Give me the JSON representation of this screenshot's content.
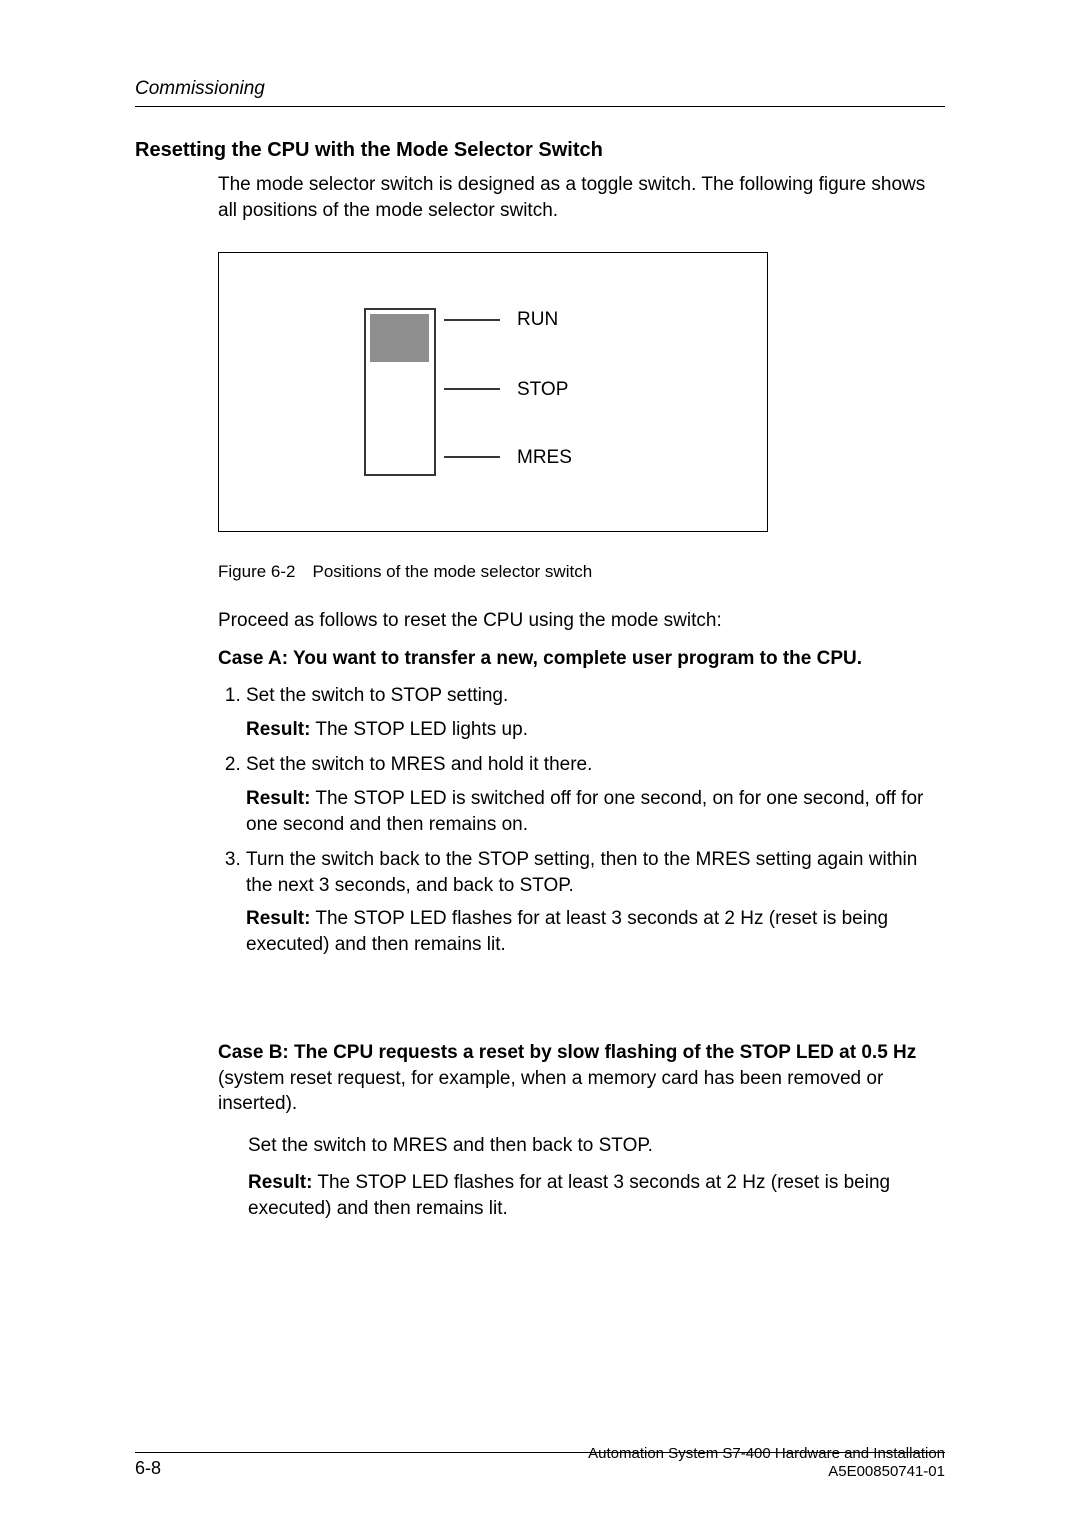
{
  "running_head": "Commissioning",
  "heading": "Resetting the CPU with the Mode Selector Switch",
  "intro": "The mode selector switch is designed as a toggle switch. The following figure shows all positions of the mode selector switch.",
  "figure": {
    "labels": {
      "run": "RUN",
      "stop": "STOP",
      "mres": "MRES"
    },
    "caption": "Figure 6-2 Positions of the mode selector switch"
  },
  "proceed": "Proceed as follows to reset the CPU using the mode switch:",
  "case_a": {
    "title": "Case A: You want to transfer a new, complete user program to the CPU.",
    "steps": [
      {
        "text": "Set the switch to STOP setting.",
        "result_label": "Result:",
        "result_text": " The STOP LED lights up."
      },
      {
        "text": "Set the switch to MRES and hold it there.",
        "result_label": "Result:",
        "result_text": " The STOP LED is switched off for one second, on for one second, off for one second and then remains on."
      },
      {
        "text": "Turn the switch back to the STOP setting, then to the MRES setting again within the next 3 seconds, and back to STOP.",
        "result_label": "Result:",
        "result_text": " The STOP LED flashes for at least 3 seconds at 2 Hz (reset is being executed) and then remains lit."
      }
    ]
  },
  "case_b": {
    "title": "Case B: The CPU requests a reset by slow flashing of the STOP LED at 0.5 Hz",
    "tail": " (system reset request, for example, when a memory card has been removed or inserted).",
    "set_line": "Set the switch to MRES and then back to STOP.",
    "result_label": "Result:",
    "result_text": " The STOP LED flashes for at least 3 seconds at 2 Hz (reset is being executed) and then remains lit."
  },
  "footer": {
    "page_no": "6-8",
    "line1": "Automation System S7-400  Hardware and Installation",
    "line2": "A5E00850741-01"
  }
}
